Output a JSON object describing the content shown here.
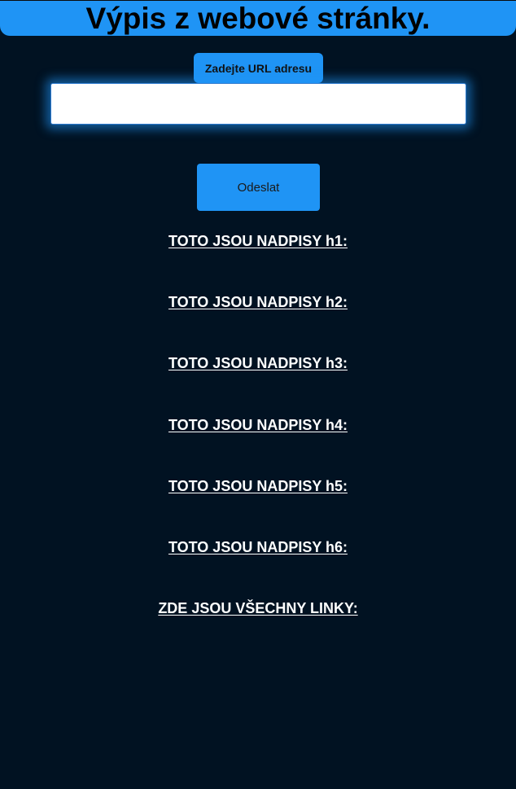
{
  "header": {
    "title": "Výpis z webové stránky."
  },
  "form": {
    "url_label": "Zadejte URL adresu",
    "url_value": "",
    "url_placeholder": "",
    "submit_label": "Odeslat"
  },
  "sections": {
    "h1": "TOTO JSOU NADPISY h1:",
    "h2": "TOTO JSOU NADPISY h2:",
    "h3": "TOTO JSOU NADPISY h3:",
    "h4": "TOTO JSOU NADPISY h4:",
    "h5": "TOTO JSOU NADPISY h5:",
    "h6": "TOTO JSOU NADPISY h6:",
    "links": "ZDE JSOU VŠECHNY LINKY:"
  },
  "colors": {
    "background": "#011222",
    "accent": "#1f94f5",
    "heading_text": "#ffffff"
  }
}
